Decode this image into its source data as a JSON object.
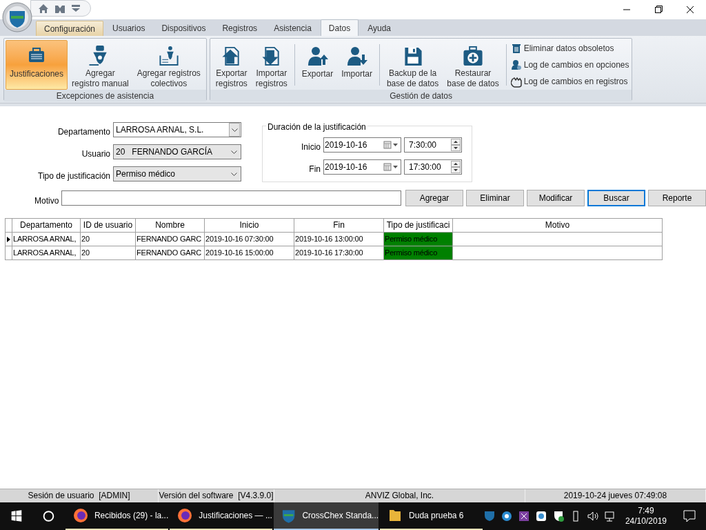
{
  "tabs": [
    {
      "label": "Configuración",
      "selected": false,
      "highlighted": true
    },
    {
      "label": "Usuarios",
      "selected": false,
      "highlighted": false
    },
    {
      "label": "Dispositivos",
      "selected": false,
      "highlighted": false
    },
    {
      "label": "Registros",
      "selected": false,
      "highlighted": false
    },
    {
      "label": "Asistencia",
      "selected": false,
      "highlighted": false
    },
    {
      "label": "Datos",
      "selected": true,
      "highlighted": false
    },
    {
      "label": "Ayuda",
      "selected": false,
      "highlighted": false
    }
  ],
  "ribbon_groups": [
    {
      "title": "Excepciones de asistencia",
      "sections": [
        {
          "kind": "large",
          "items": [
            {
              "label": "Justificaciones",
              "selected": true
            },
            {
              "label": "Agregar\nregistro manual",
              "selected": false
            },
            {
              "label": "Agregar registros\ncolectivos",
              "selected": false
            }
          ]
        }
      ]
    },
    {
      "title": "Gestión de datos",
      "sections": [
        {
          "kind": "large",
          "items": [
            {
              "label": "Exportar\nregistros",
              "selected": false
            },
            {
              "label": "Importar\nregistros",
              "selected": false
            }
          ]
        },
        {
          "kind": "large",
          "items": [
            {
              "label": "Exportar",
              "selected": false
            },
            {
              "label": "Importar",
              "selected": false
            }
          ]
        },
        {
          "kind": "large",
          "items": [
            {
              "label": "Backup de la\nbase de datos",
              "selected": false
            },
            {
              "label": "Restaurar\nbase de datos",
              "selected": false
            }
          ]
        },
        {
          "kind": "list",
          "items": [
            {
              "label": "Eliminar datos obsoletos",
              "selected": false
            },
            {
              "label": "Log de cambios en opciones",
              "selected": false
            },
            {
              "label": "Log de cambios en registros",
              "selected": false
            }
          ]
        }
      ]
    }
  ],
  "form": {
    "departamento": {
      "label": "Departamento",
      "value": "LARROSA ARNAL, S.L."
    },
    "usuario": {
      "label": "Usuario",
      "value": "20   FERNANDO GARCÍA"
    },
    "tipo": {
      "label": "Tipo de justificación",
      "value": "Permiso médico"
    },
    "duracion": {
      "title": "Duración de la justificación",
      "inicio": {
        "label": "Inicio",
        "date": "2019-10-16",
        "time": "7:30:00"
      },
      "fin": {
        "label": "Fin",
        "date": "2019-10-16",
        "time": "17:30:00"
      }
    },
    "motivo": {
      "label": "Motivo"
    },
    "buttons": [
      {
        "label": "Agregar",
        "focused": false
      },
      {
        "label": "Eliminar",
        "focused": false
      },
      {
        "label": "Modificar",
        "focused": false
      },
      {
        "label": "Buscar",
        "focused": true
      },
      {
        "label": "Reporte",
        "focused": false
      }
    ]
  },
  "table": {
    "columns": [
      "Departamento",
      "ID de usuario",
      "Nombre",
      "Inicio",
      "Fin",
      "Tipo de justificaci",
      "Motivo"
    ],
    "rows": [
      {
        "current": true,
        "color": "#008000",
        "cells": [
          "LARROSA ARNAL,",
          "20",
          "FERNANDO GARC",
          "2019-10-16 07:30:00",
          "2019-10-16 13:00:00",
          "Permiso médico",
          ""
        ]
      },
      {
        "current": false,
        "color": "#008000",
        "cells": [
          "LARROSA ARNAL,",
          "20",
          "FERNANDO GARC",
          "2019-10-16 15:00:00",
          "2019-10-16 17:30:00",
          "Permiso médico",
          ""
        ]
      }
    ]
  },
  "status_bar": [
    "Sesión de usuario  [ADMIN]",
    "Versión del software  [V4.3.9.0]",
    "ANVIZ Global, Inc.",
    "2019-10-24 jueves 07:49:08"
  ],
  "taskbar": {
    "items": [
      {
        "label": "Recibidos (29) - la...",
        "selected": false
      },
      {
        "label": "Justificaciones — ...",
        "selected": false
      },
      {
        "label": "CrossChex Standa...",
        "selected": true
      },
      {
        "label": "Duda prueba 6",
        "selected": false
      }
    ],
    "time": "7:49",
    "date": "24/10/2019"
  }
}
